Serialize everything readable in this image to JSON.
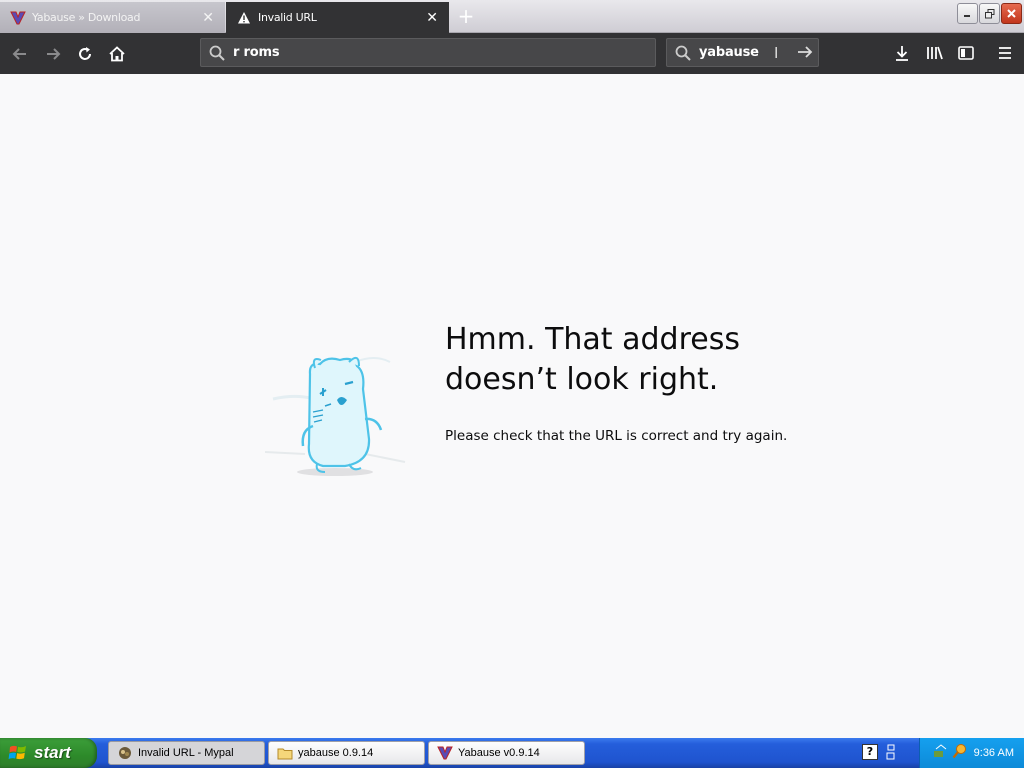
{
  "browser": {
    "tabs": [
      {
        "title": "Yabause » Download",
        "active": false
      },
      {
        "title": "Invalid URL",
        "active": true
      }
    ],
    "url_text": "r roms",
    "search_text": "yabause"
  },
  "error_page": {
    "title_line1": "Hmm. That address",
    "title_line2": "doesn’t look right.",
    "description": "Please check that the URL is correct and try again."
  },
  "taskbar": {
    "start_label": "start",
    "tasks": [
      {
        "label": "Invalid URL - Mypal",
        "active": true
      },
      {
        "label": "yabause 0.9.14",
        "active": false
      },
      {
        "label": "Yabause v0.9.14",
        "active": false
      }
    ],
    "clock": "9:36 AM"
  },
  "colors": {
    "toolbar": "#323234",
    "page_bg": "#f9f9fa",
    "taskbar": "#245edb",
    "start": "#3c9e3a"
  }
}
